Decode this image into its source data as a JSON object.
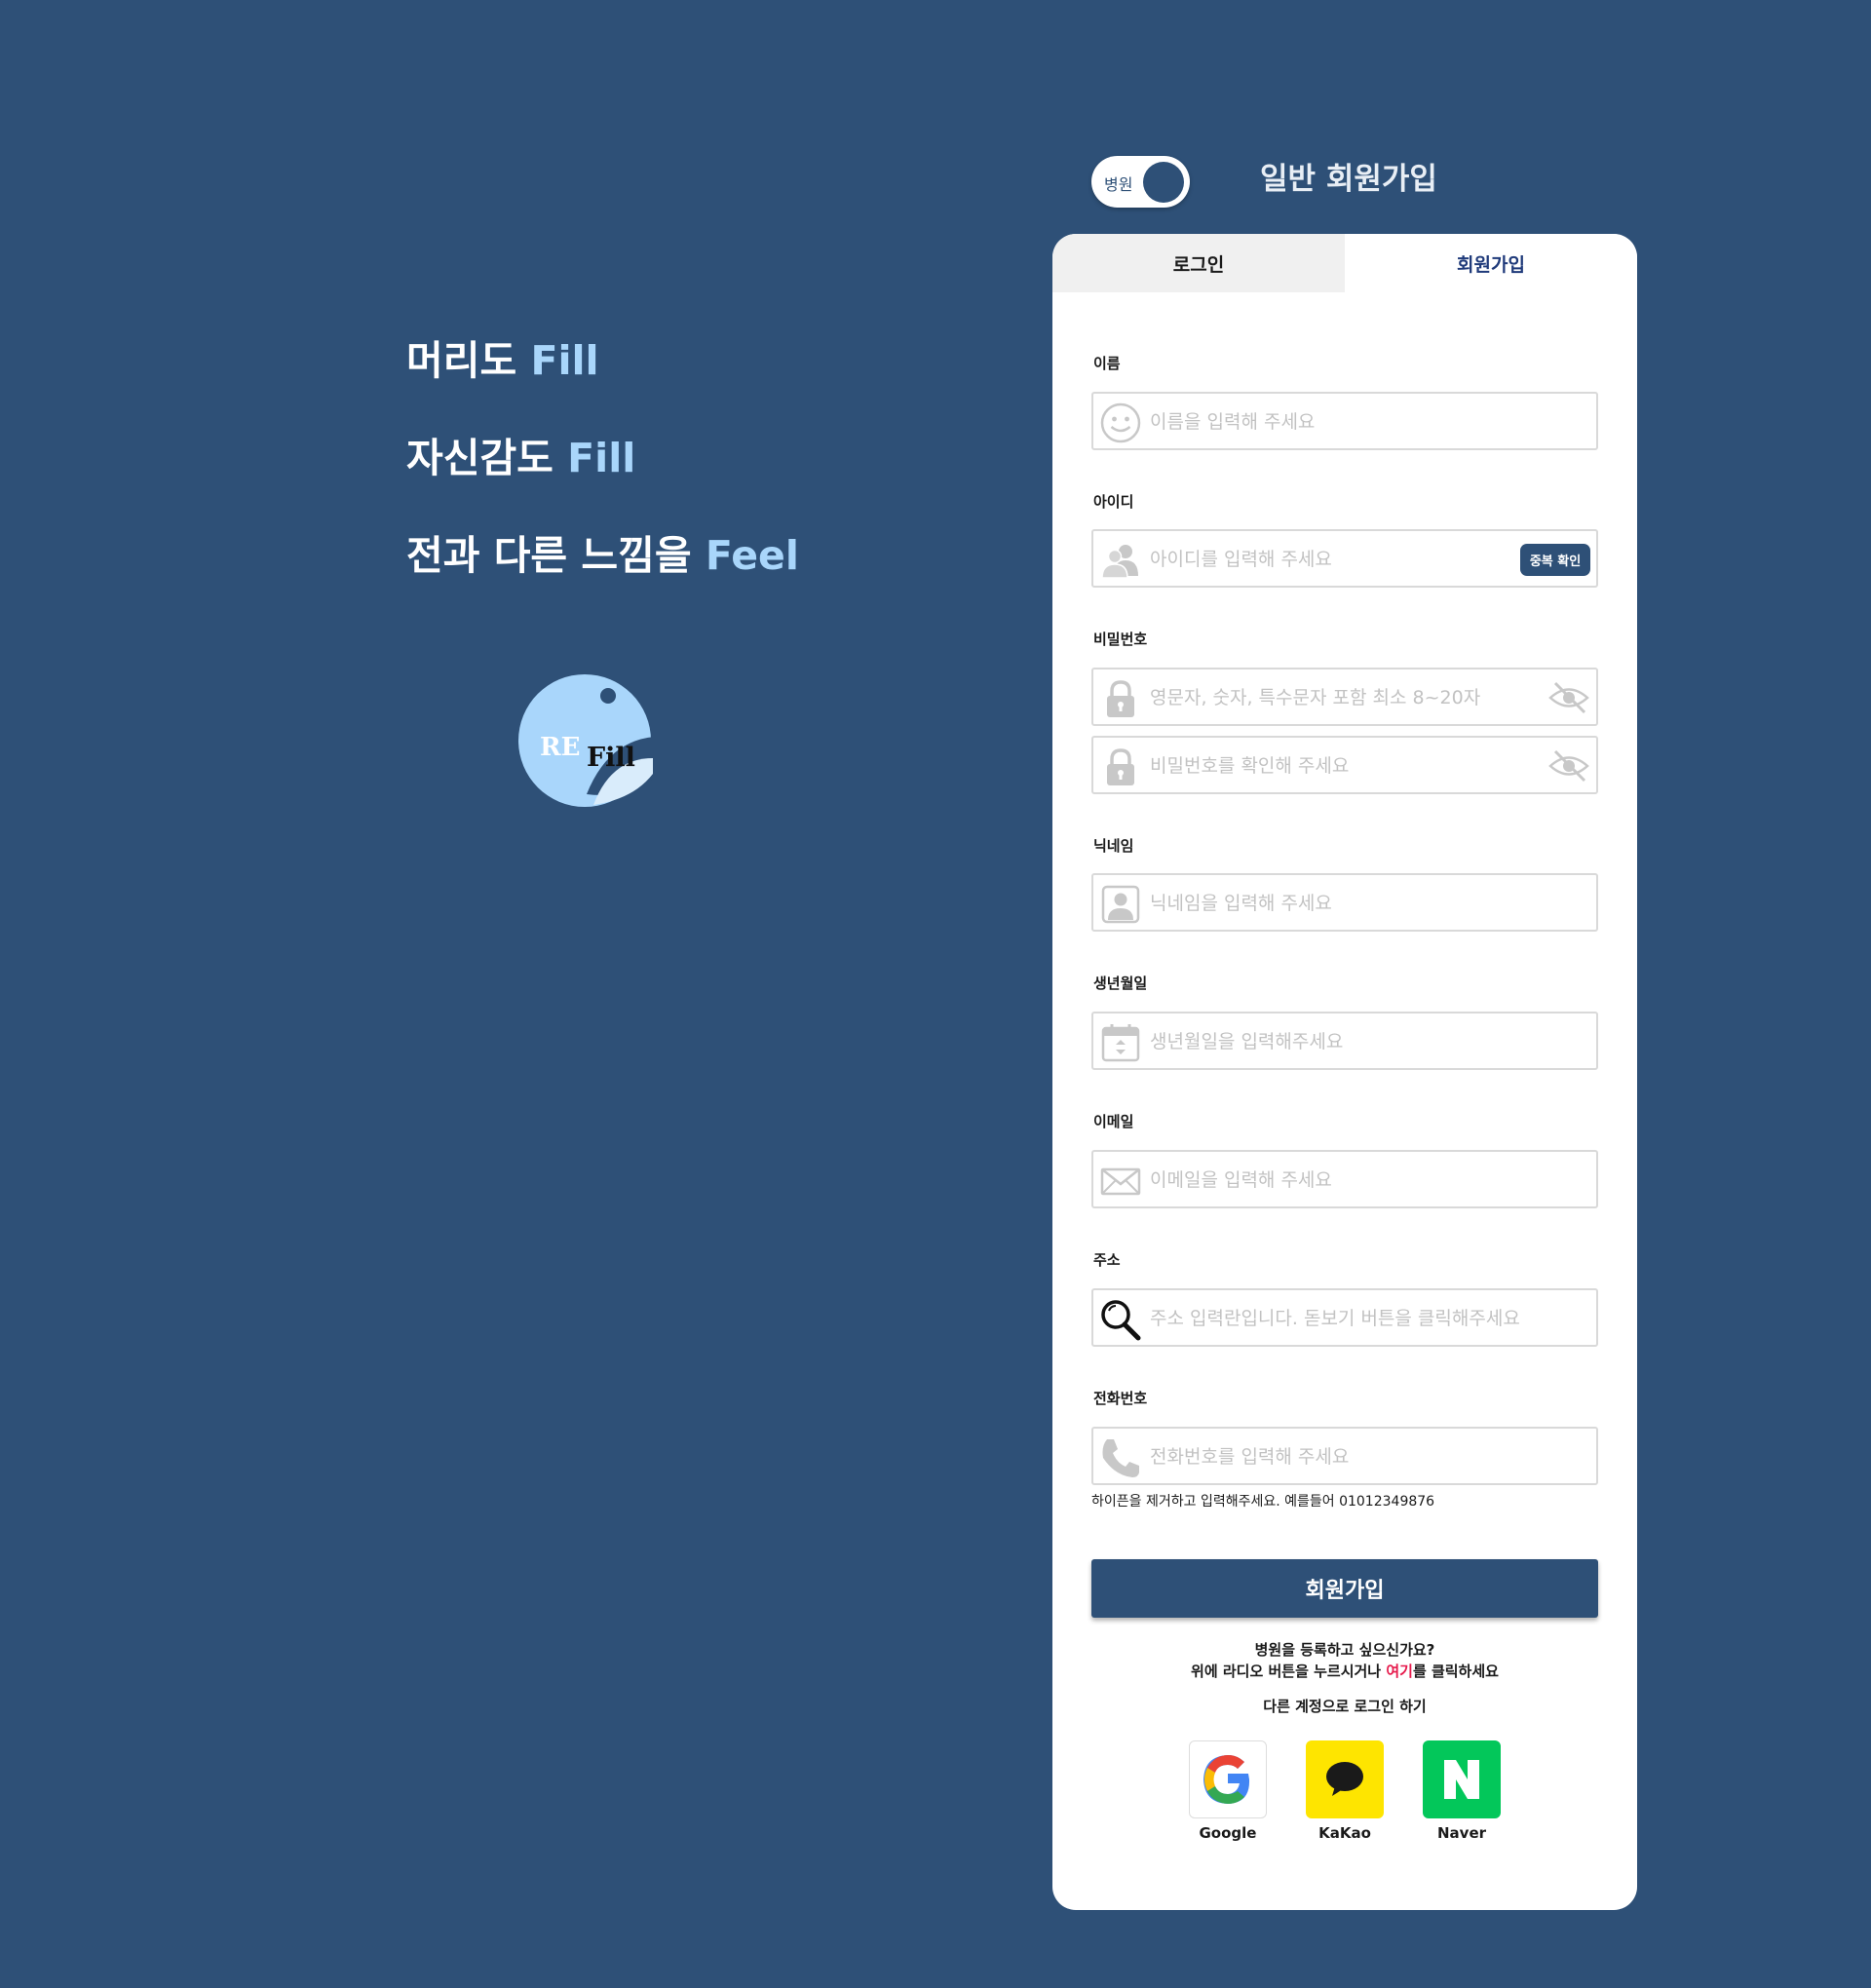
{
  "brand": {
    "slogan": [
      {
        "text": "머리도 ",
        "accent": "Fill"
      },
      {
        "text": "자신감도 ",
        "accent": "Fill"
      },
      {
        "text": "전과 다른 느낌을 ",
        "accent": "Feel"
      }
    ],
    "logo_text_left": "RE",
    "logo_text_right": "Fill"
  },
  "toggle": {
    "label": "병원"
  },
  "heading": "일반 회원가입",
  "tabs": {
    "login": "로그인",
    "signup": "회원가입"
  },
  "form": {
    "name": {
      "label": "이름",
      "placeholder": "이름을 입력해 주세요"
    },
    "id": {
      "label": "아이디",
      "placeholder": "아이디를 입력해 주세요",
      "dup_button": "중복 확인"
    },
    "password": {
      "label": "비밀번호",
      "placeholder": "영문자, 숫자, 특수문자 포함 최소 8~20자",
      "confirm_placeholder": "비밀번호를 확인해 주세요"
    },
    "nickname": {
      "label": "닉네임",
      "placeholder": "닉네임을 입력해 주세요"
    },
    "birth": {
      "label": "생년월일",
      "placeholder": "생년월일을 입력해주세요"
    },
    "email": {
      "label": "이메일",
      "placeholder": "이메일을 입력해 주세요"
    },
    "address": {
      "label": "주소",
      "placeholder": "주소 입력란입니다. 돋보기 버튼을 클릭해주세요"
    },
    "phone": {
      "label": "전화번호",
      "placeholder": "전화번호를 입력해 주세요",
      "hint": "하이픈을 제거하고 입력해주세요. 예를들어 01012349876"
    },
    "submit": "회원가입"
  },
  "hospital_prompt": {
    "line1": "병원을 등록하고 싶으신가요?",
    "line2_before": "위에 라디오 버튼을 누르시거나 ",
    "line2_link": "여기",
    "line2_after": "를 클릭하세요"
  },
  "social": {
    "title": "다른 계정으로 로그인 하기",
    "providers": [
      {
        "name": "Google",
        "color": "#ffffff"
      },
      {
        "name": "KaKao",
        "color": "#fee500"
      },
      {
        "name": "Naver",
        "color": "#03c75a"
      }
    ]
  },
  "colors": {
    "background": "#2e5077",
    "accent_text": "#a9d6fb",
    "link": "#e6194b",
    "tab_active": "#1f3a7a"
  }
}
